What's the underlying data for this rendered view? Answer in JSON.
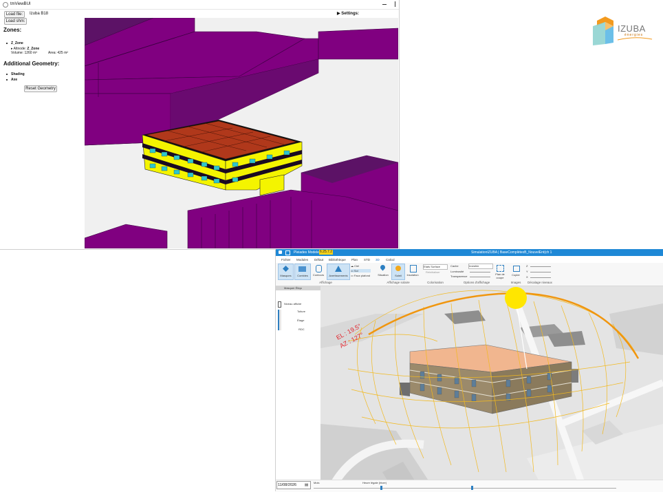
{
  "viewer": {
    "title": "tmViewBUI",
    "load_file_label": "Load file:",
    "load_shm_label": "Load shm:",
    "file_name": "Izuba B18",
    "settings_label": "▶ Settings:",
    "zones_heading": "Zones:",
    "zone_name": "Z_Zone",
    "zone_detail_prefix": "▸ Altnode:",
    "zone_detail_name": "Z_Zone",
    "zone_volume": "Volume: 1260 m³",
    "zone_area": "Area: 425 m²",
    "additional_heading": "Additional Geometry:",
    "geom_items": [
      "Shading",
      "Axe"
    ],
    "reset_label": "Reset Geometry"
  },
  "logo": {
    "brand": "IZUBA",
    "sub": "énergies",
    "colors": {
      "orange": "#f39a1e",
      "blue": "#5bb8e6",
      "teal": "#8fd3d0"
    }
  },
  "pleiades": {
    "quick_access": "Pleiades Modeleur",
    "version_badge": "6.25.7.2",
    "window_title": "SimulationIZUBA | BaseComplètexB_NouvelEnt(ch 1",
    "menu": [
      "Fichier",
      "Modules",
      "Défaut",
      "Bibliothèque",
      "Plan",
      "STD",
      "3D",
      "Calcul"
    ],
    "active_menu": "3D",
    "ribbon": {
      "masques": "Masques",
      "combles": "Combles",
      "contours": "Contours",
      "avertissements": "Avertissements",
      "ciel": "Ciel",
      "sol": "Sol",
      "faux_plafond": "Faux plafond",
      "situation": "Situation",
      "soleil": "Soleil",
      "insolation": "Insolation",
      "etats_surface": "Etats Surface",
      "reinitialiser": "Réinitialiser",
      "cache_label": "Cache",
      "cache_value": "Invisible",
      "luminosite": "Luminosité",
      "transparence": "Transparence",
      "plan_de_coupe": "Plan de coupe",
      "copier": "Copier",
      "z": "Z",
      "y": "Y",
      "x": "X",
      "groups": [
        "Affichage",
        "Affichage solaire",
        "Colorisation",
        "Options d'affichage",
        "Images",
        "Décalage niveaux"
      ]
    },
    "side_panel": {
      "header": "Masquer Étiqu",
      "niveau_affiche": "Niveau affiché",
      "levels": [
        "Toiture",
        "Étage",
        "RDC"
      ]
    },
    "scene_labels": [
      "AZ : 127°",
      "EL : 19.5°"
    ],
    "bottom": {
      "date": "11/08/2026",
      "mois": "Mois",
      "heure": "Heure légale (hiver)",
      "date_progress": 0.22,
      "hour_progress": 0.52
    }
  }
}
